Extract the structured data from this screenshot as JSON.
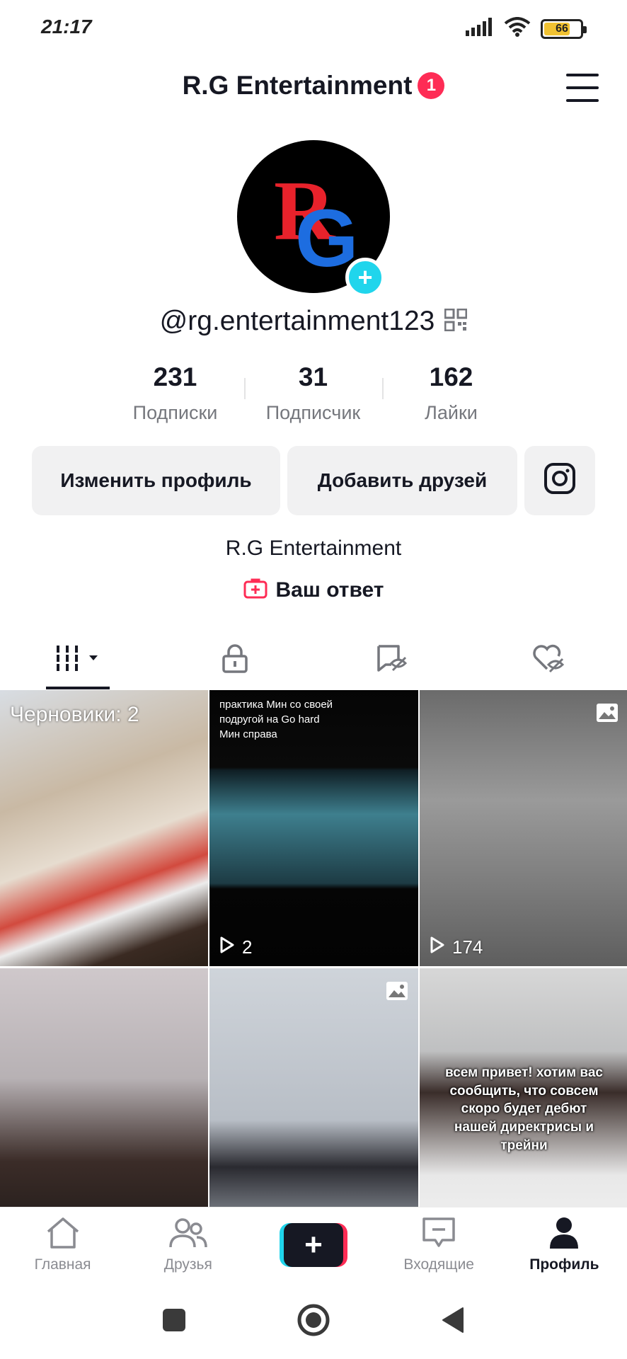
{
  "status_bar": {
    "time": "21:17",
    "battery": "66",
    "battery_level": 0.66
  },
  "header": {
    "title": "R.G Entertainment",
    "notification_count": "1"
  },
  "profile": {
    "avatar_text": "RG",
    "username": "@rg.entertainment123",
    "stats": [
      {
        "value": "231",
        "label": "Подписки"
      },
      {
        "value": "31",
        "label": "Подписчик"
      },
      {
        "value": "162",
        "label": "Лайки"
      }
    ],
    "buttons": {
      "edit": "Изменить профиль",
      "add_friends": "Добавить друзей"
    },
    "bio": "R.G Entertainment",
    "answer_label": "Ваш ответ"
  },
  "tabs": [
    {
      "icon": "videos-grid-icon",
      "active": true
    },
    {
      "icon": "lock-icon",
      "active": false
    },
    {
      "icon": "hidden-reposts-icon",
      "active": false
    },
    {
      "icon": "hidden-likes-icon",
      "active": false
    }
  ],
  "grid": {
    "drafts_label": "Черновики: 2",
    "cell2_caption_line1": "практика Мин со своей",
    "cell2_caption_line2": "подругой на Go hard",
    "cell2_caption_line3": "Мин справа",
    "cell2_views": "2",
    "cell3_views": "174",
    "cell6_caption": "всем привет! хотим вас сообщить, что совсем скоро будет дебют нашей директрисы и трейни"
  },
  "bottom_nav": {
    "home": "Главная",
    "friends": "Друзья",
    "inbox": "Входящие",
    "profile": "Профиль"
  },
  "colors": {
    "accent": "#fe2c55",
    "cyan": "#20d5ec",
    "text": "#161823",
    "muted": "#75777d"
  }
}
